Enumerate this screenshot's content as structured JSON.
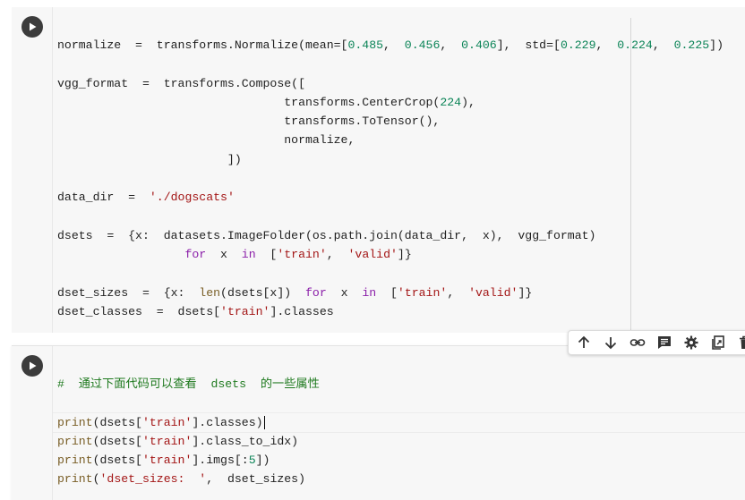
{
  "cells": [
    {
      "lines": [
        [
          [
            "normalize  =  transforms.Normalize(mean=[",
            ""
          ],
          [
            "0.485",
            "num"
          ],
          [
            ",  ",
            ""
          ],
          [
            "0.456",
            "num"
          ],
          [
            ",  ",
            ""
          ],
          [
            "0.406",
            "num"
          ],
          [
            "],  std=[",
            ""
          ],
          [
            "0.229",
            "num"
          ],
          [
            ",  ",
            ""
          ],
          [
            "0.224",
            "num"
          ],
          [
            ",  ",
            ""
          ],
          [
            "0.225",
            "num"
          ],
          [
            "])",
            ""
          ]
        ],
        [],
        [
          [
            "vgg_format  =  transforms.Compose([",
            ""
          ]
        ],
        [
          [
            "                                transforms.CenterCrop(",
            ""
          ],
          [
            "224",
            "num"
          ],
          [
            "),",
            ""
          ]
        ],
        [
          [
            "                                transforms.ToTensor(),",
            ""
          ]
        ],
        [
          [
            "                                normalize,",
            ""
          ]
        ],
        [
          [
            "                        ])",
            ""
          ]
        ],
        [],
        [
          [
            "data_dir  =  ",
            ""
          ],
          [
            "'./dogscats'",
            "str"
          ]
        ],
        [],
        [
          [
            "dsets  =  {x:  datasets.ImageFolder(os.path.join(data_dir,  x),  vgg_format)",
            ""
          ]
        ],
        [
          [
            "                  ",
            ""
          ],
          [
            "for",
            "kw"
          ],
          [
            "  x  ",
            ""
          ],
          [
            "in",
            "kw"
          ],
          [
            "  [",
            ""
          ],
          [
            "'train'",
            "str"
          ],
          [
            ",  ",
            ""
          ],
          [
            "'valid'",
            "str"
          ],
          [
            "]}",
            ""
          ]
        ],
        [],
        [
          [
            "dset_sizes  =  {x:  ",
            ""
          ],
          [
            "len",
            "fn"
          ],
          [
            "(dsets[x])  ",
            ""
          ],
          [
            "for",
            "kw"
          ],
          [
            "  x  ",
            ""
          ],
          [
            "in",
            "kw"
          ],
          [
            "  [",
            ""
          ],
          [
            "'train'",
            "str"
          ],
          [
            ",  ",
            ""
          ],
          [
            "'valid'",
            "str"
          ],
          [
            "]}",
            ""
          ]
        ],
        [
          [
            "dset_classes  =  dsets[",
            ""
          ],
          [
            "'train'",
            "str"
          ],
          [
            "].classes",
            ""
          ]
        ]
      ]
    },
    {
      "lines": [
        [
          [
            "#  通过下面代码可以查看  dsets  的一些属性",
            "cm"
          ]
        ],
        [],
        [
          [
            "print",
            "fn"
          ],
          [
            "(dsets[",
            ""
          ],
          [
            "'train'",
            "str"
          ],
          [
            "].classes)",
            ""
          ]
        ],
        [
          [
            "print",
            "fn"
          ],
          [
            "(dsets[",
            ""
          ],
          [
            "'train'",
            "str"
          ],
          [
            "].class_to_idx)",
            ""
          ]
        ],
        [
          [
            "print",
            "fn"
          ],
          [
            "(dsets[",
            ""
          ],
          [
            "'train'",
            "str"
          ],
          [
            "].imgs[:",
            ""
          ],
          [
            "5",
            "num"
          ],
          [
            "])",
            ""
          ]
        ],
        [
          [
            "print",
            "fn"
          ],
          [
            "(",
            ""
          ],
          [
            "'dset_sizes:  '",
            "str"
          ],
          [
            ",  dset_sizes)",
            ""
          ]
        ]
      ]
    }
  ],
  "toolbar": {
    "buttons": [
      "arrow-up-icon",
      "arrow-down-icon",
      "link-icon",
      "comment-icon",
      "gear-icon",
      "mirror-cell-icon",
      "delete-icon"
    ]
  },
  "colors": {
    "keyword": "#8b1fa9",
    "number": "#0b8457",
    "string": "#a31515",
    "comment": "#1f7a1f"
  }
}
